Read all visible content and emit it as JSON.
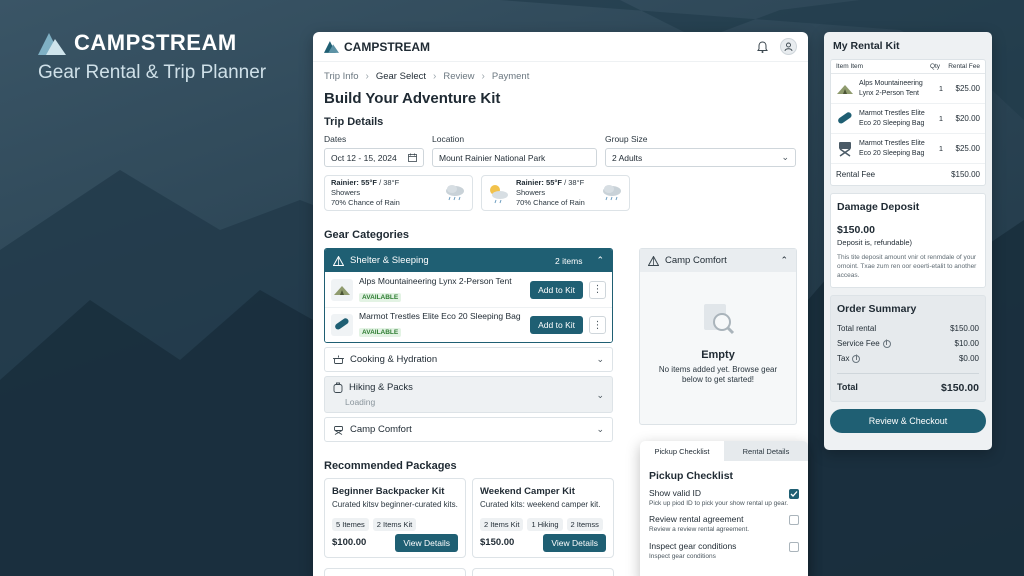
{
  "hero": {
    "brand": "CAMPSTREAM",
    "tagline": "Gear Rental & Trip Planner"
  },
  "app": {
    "brand": "CAMPSTREAM"
  },
  "breadcrumb": [
    "Trip Info",
    "Gear Select",
    "Review",
    "Payment"
  ],
  "page_title": "Build Your Adventure Kit",
  "trip": {
    "title": "Trip Details",
    "dates_label": "Dates",
    "dates_value": "Oct 12 - 15, 2024",
    "location_label": "Location",
    "location_value": "Mount Rainier National Park",
    "group_label": "Group Size",
    "group_value": "2 Adults"
  },
  "weather": [
    {
      "place": "Rainier:",
      "temp": "55°F",
      "low": "/ 38°F",
      "cond": "Showers",
      "chance": "70% Chance of Rain"
    },
    {
      "place": "Rainier:",
      "temp": "55°F",
      "low": "/ 38°F",
      "cond": "Showers",
      "chance": "70% Chance of Rain"
    }
  ],
  "gear": {
    "title": "Gear Categories",
    "shelter": {
      "label": "Shelter & Sleeping",
      "count": "2 items"
    },
    "items": [
      {
        "name": "Alps Mountaineering Lynx 2-Person Tent",
        "status": "AVAILABLE",
        "action": "Add to Kit"
      },
      {
        "name": "Marmot Trestles Elite Eco 20 Sleeping Bag",
        "status": "AVAILABLE",
        "action": "Add to Kit"
      }
    ],
    "cooking": "Cooking & Hydration",
    "hiking": {
      "label": "Hiking & Packs",
      "loading": "Loading"
    },
    "comfort": "Camp Comfort"
  },
  "camp_comfort": {
    "label": "Camp Comfort",
    "empty_title": "Empty",
    "empty_desc": "No items added yet. Browse gear below to get started!"
  },
  "recommended": {
    "title": "Recommended Packages",
    "packages": [
      {
        "name": "Beginner Backpacker Kit",
        "desc": "Curated kitsv beginner-curated kits.",
        "chips": [
          "5 Itemes",
          "2 Items Kit"
        ],
        "price": "$100.00",
        "action": "View Details"
      },
      {
        "name": "Weekend Camper Kit",
        "desc": "Curated kits: weekend camper kit.",
        "chips": [
          "2 Items Kit",
          "1 Hiking",
          "2 Itemss"
        ],
        "price": "$150.00",
        "action": "View Details"
      }
    ]
  },
  "kit": {
    "title": "My Rental Kit",
    "headers": {
      "item": "Item Item",
      "qty": "Qty",
      "fee": "Rental Fee"
    },
    "rows": [
      {
        "name": "Alps Mountaineering Lynx 2-Person Tent",
        "qty": "1",
        "fee": "$25.00"
      },
      {
        "name": "Marmot Trestles Elite Eco 20 Sleeping Bag",
        "qty": "1",
        "fee": "$20.00"
      },
      {
        "name": "Marmot Trestles Elite Eco 20 Sleeping Bag",
        "qty": "1",
        "fee": "$25.00"
      }
    ],
    "fee_label": "Rental Fee",
    "fee_value": "$150.00"
  },
  "deposit": {
    "title": "Damage Deposit",
    "amount": "$150.00",
    "sub": "Deposit is, refundable)",
    "note": "This tite deposit amount vnir ot renmdale of your ornoint. Txae zum ren oor eoerti-etalit to another acceas."
  },
  "summary": {
    "title": "Order Summary",
    "rental_label": "Total rental",
    "rental_value": "$150.00",
    "service_label": "Service Fee",
    "service_value": "$10.00",
    "tax_label": "Tax",
    "tax_value": "$0.00",
    "total_label": "Total",
    "total_value": "$150.00",
    "checkout": "Review & Checkout"
  },
  "pickup": {
    "tabs": [
      "Pickup Checklist",
      "Rental Details"
    ],
    "title": "Pickup Checklist",
    "items": [
      {
        "name": "Show valid ID",
        "sub": "Pick up piod ID to pick your show rental up gear.",
        "checked": true
      },
      {
        "name": "Review rental agreement",
        "sub": "Review a review rental agreement.",
        "checked": false
      },
      {
        "name": "Inspect gear conditions",
        "sub": "Inspect gear conditions",
        "checked": false
      }
    ]
  },
  "colors": {
    "accent": "#1f5f73",
    "available": "#2e7d32",
    "background": "#2a4353"
  }
}
